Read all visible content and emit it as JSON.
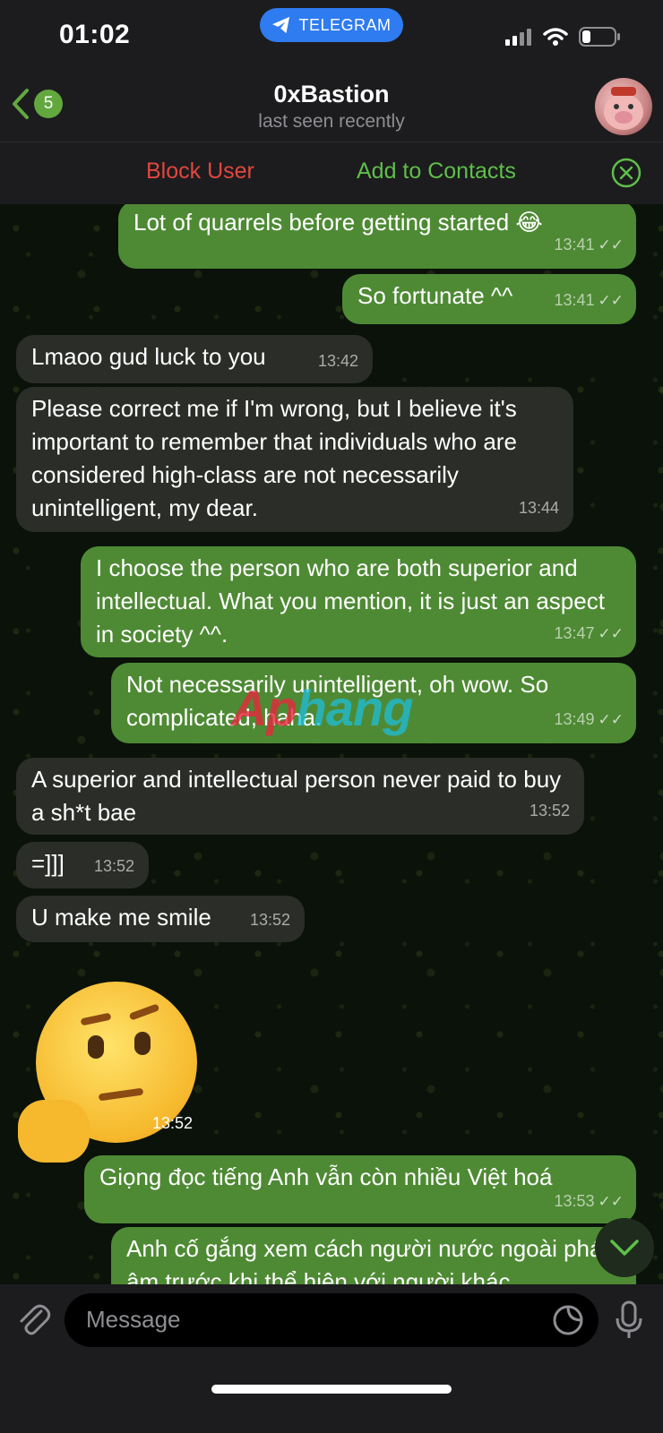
{
  "status_bar": {
    "time": "01:02",
    "app_pill": "TELEGRAM"
  },
  "header": {
    "back_badge": "5",
    "title": "0xBastion",
    "subtitle": "last seen recently"
  },
  "action_bar": {
    "block_label": "Block User",
    "add_label": "Add to Contacts"
  },
  "messages": [
    {
      "dir": "out",
      "text": "Lot of quarrels before getting started 😂",
      "time": "13:41"
    },
    {
      "dir": "out",
      "text": "So fortunate ^^",
      "time": "13:41"
    },
    {
      "dir": "in",
      "text": "Lmaoo gud luck to you",
      "time": "13:42"
    },
    {
      "dir": "in",
      "text": "Please correct me if I'm wrong, but I believe it's important to remember that individuals who are considered high-class are not necessarily unintelligent, my dear.",
      "time": "13:44"
    },
    {
      "dir": "out",
      "text": "I choose the person who are both superior and intellectual. What you mention, it is just an aspect in society ^^.",
      "time": "13:47"
    },
    {
      "dir": "out",
      "text": "Not necessarily unintelligent, oh wow. So complicated, haha.",
      "time": "13:49"
    },
    {
      "dir": "in",
      "text": "A superior and intellectual person never paid to buy a sh*t bae",
      "time": "13:52"
    },
    {
      "dir": "in",
      "text": "=]]]",
      "time": "13:52"
    },
    {
      "dir": "in",
      "text": "U make me smile",
      "time": "13:52"
    },
    {
      "dir": "in",
      "text": "",
      "time": "13:52",
      "sticker": "thinking-face-emoji"
    },
    {
      "dir": "out",
      "text": "Giọng đọc tiếng Anh vẫn còn nhiều Việt hoá",
      "time": "13:53"
    },
    {
      "dir": "out",
      "text": "Anh cố gắng xem cách người nước ngoài phát âm trước khi thể hiện với người khác",
      "time": ""
    }
  ],
  "watermark": {
    "part1": "Ap",
    "part2": "hang"
  },
  "composer": {
    "placeholder": "Message"
  },
  "colors": {
    "outgoing_bubble": "#4e8a34",
    "incoming_bubble": "#2a2d28",
    "block_red": "#e2463f",
    "contact_green": "#5fbf4a",
    "telegram_blue": "#2f7bf0"
  }
}
